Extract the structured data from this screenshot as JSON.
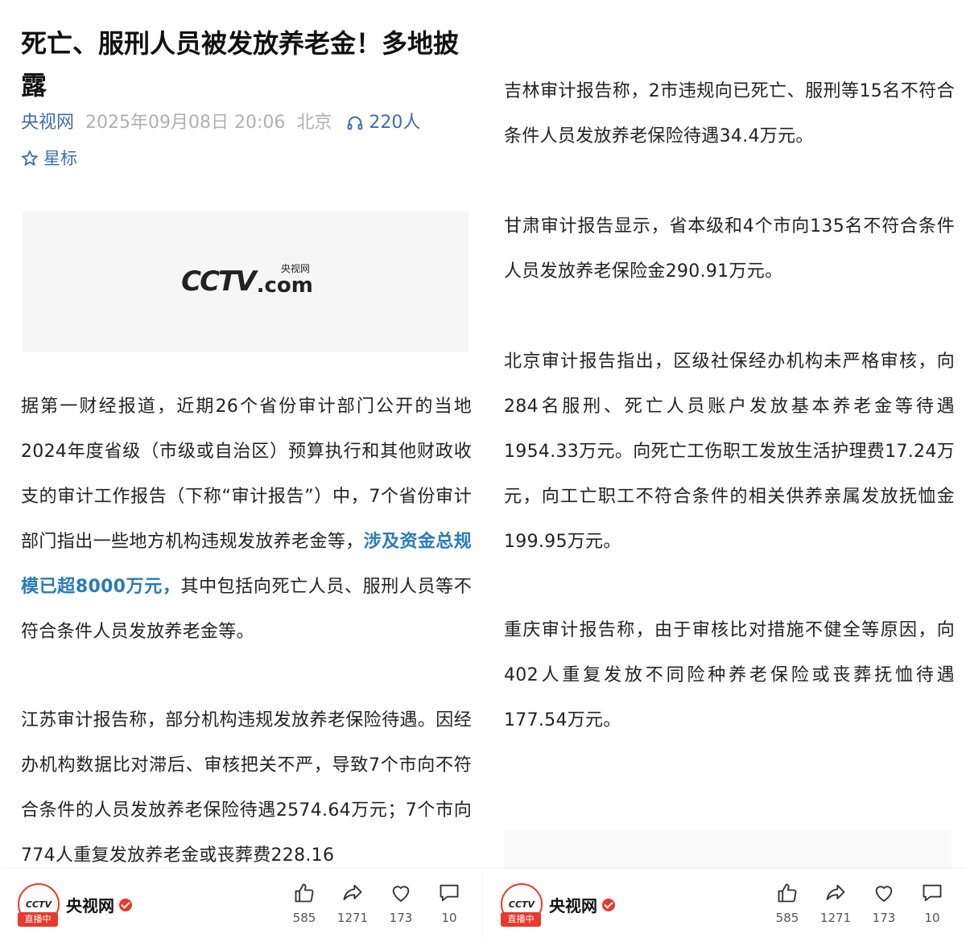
{
  "left": {
    "title": "死亡、服刑人员被发放养老金！多地披露",
    "meta": {
      "source": "央视网",
      "date": "2025年09月08日 20:06",
      "city": "北京",
      "listeners": "220人"
    },
    "star_label": "星标",
    "banner": {
      "logo_text": "CCTV",
      "logo_com": ".com",
      "logo_cn": "央视网"
    },
    "paragraph1": {
      "before": "据第一财经报道，近期26个省份审计部门公开的当地2024年度省级（市级或自治区）预算执行和其他财政收支的审计工作报告（下称“审计报告”）中，7个省份审计部门指出一些地方机构违规发放养老金等，",
      "highlight": "涉及资金总规模已超8000万元，",
      "after": "其中包括向死亡人员、服刑人员等不符合条件人员发放养老金等。"
    },
    "paragraph2": "江苏审计报告称，部分机构违规发放养老保险待遇。因经办机构数据比对滞后、审核把关不严，导致7个市向不符合条件的人员发放养老保险待遇2574.64万元；7个市向774人重复发放养老金或丧葬费228.16"
  },
  "right": {
    "paragraph1": "吉林审计报告称，2市违规向已死亡、服刑等15名不符合条件人员发放养老保险待遇34.4万元。",
    "paragraph2": "甘肃审计报告显示，省本级和4个市向135名不符合条件人员发放养老保险金290.91万元。",
    "paragraph3": "北京审计报告指出，区级社保经办机构未严格审核，向284名服刑、死亡人员账户发放基本养老金等待遇1954.33万元。向死亡工伤职工发放生活护理费17.24万元，向工亡职工不符合条件的相关供养亲属发放抚恤金199.95万元。",
    "paragraph4": "重庆审计报告称，由于审核比对措施不健全等原因，向402人重复发放不同险种养老保险或丧葬抚恤待遇177.54万元。"
  },
  "footer": {
    "account_name": "央视网",
    "live_badge": "直播中",
    "avatar_text": "CCTV",
    "likes": "585",
    "shares": "1271",
    "favorites": "173",
    "comments": "10"
  },
  "colors": {
    "link_blue": "#3d6ea8",
    "highlight_blue": "#2a7ab8",
    "brand_red": "#e63a2e",
    "meta_gray": "#b0b0b0"
  },
  "icons": [
    "headphones-icon",
    "star-icon",
    "like-icon",
    "share-icon",
    "heart-icon",
    "comment-icon",
    "verified-icon"
  ]
}
